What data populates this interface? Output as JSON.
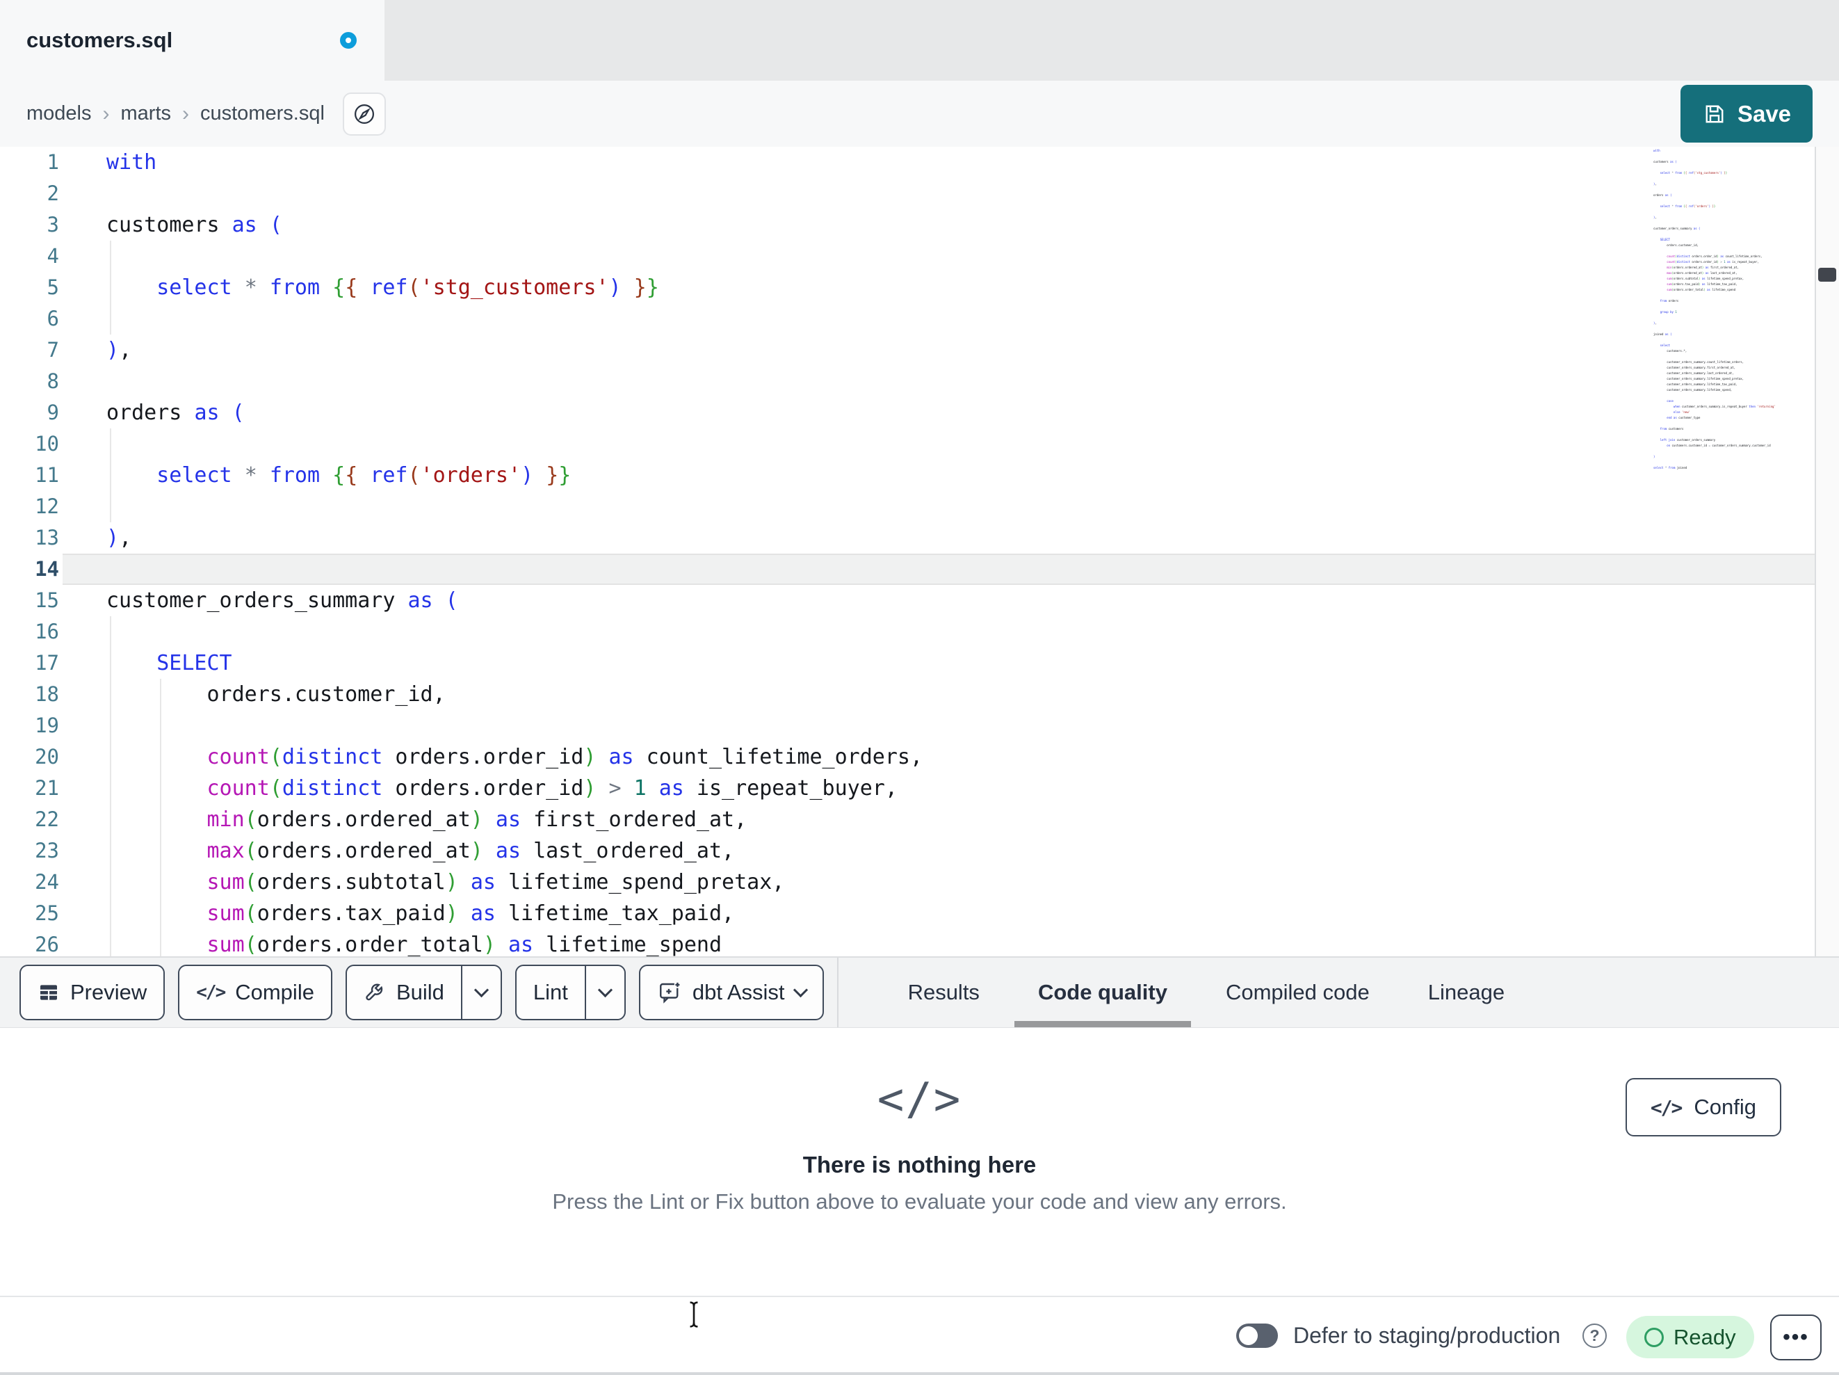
{
  "tab_bar": {
    "title": "customers.sql",
    "unsaved": true
  },
  "breadcrumb": {
    "items": [
      "models",
      "marts",
      "customers.sql"
    ],
    "separator": "›"
  },
  "header": {
    "save_label": "Save"
  },
  "icons": {
    "new_tab": "+",
    "help": "?",
    "more": "•••",
    "code_glyph": "</>"
  },
  "editor": {
    "visible_lines": 26,
    "active_line": 14,
    "lines": [
      {
        "t": [
          [
            "kw",
            "with"
          ]
        ]
      },
      {
        "t": []
      },
      {
        "t": [
          [
            "pl",
            "customers "
          ],
          [
            "kw",
            "as"
          ],
          [
            "pl",
            " "
          ],
          [
            "brb",
            "("
          ]
        ]
      },
      {
        "t": [],
        "g": [
          1
        ]
      },
      {
        "t": [
          [
            "pl",
            "    "
          ],
          [
            "kw",
            "select"
          ],
          [
            "pl",
            " "
          ],
          [
            "op",
            "*"
          ],
          [
            "pl",
            " "
          ],
          [
            "kw",
            "from"
          ],
          [
            "pl",
            " "
          ],
          [
            "brg",
            "{"
          ],
          [
            "brm",
            "{"
          ],
          [
            "pl",
            " "
          ],
          [
            "kw",
            "ref"
          ],
          [
            "brm",
            "("
          ],
          [
            "str",
            "'stg_customers'"
          ],
          [
            "brb",
            ")"
          ],
          [
            "pl",
            " "
          ],
          [
            "brm",
            "}"
          ],
          [
            "brg",
            "}"
          ]
        ],
        "g": [
          1
        ]
      },
      {
        "t": [],
        "g": [
          1
        ]
      },
      {
        "t": [
          [
            "brb",
            ")"
          ],
          [
            "pl",
            ","
          ]
        ]
      },
      {
        "t": []
      },
      {
        "t": [
          [
            "pl",
            "orders "
          ],
          [
            "kw",
            "as"
          ],
          [
            "pl",
            " "
          ],
          [
            "brb",
            "("
          ]
        ]
      },
      {
        "t": [],
        "g": [
          1
        ]
      },
      {
        "t": [
          [
            "pl",
            "    "
          ],
          [
            "kw",
            "select"
          ],
          [
            "pl",
            " "
          ],
          [
            "op",
            "*"
          ],
          [
            "pl",
            " "
          ],
          [
            "kw",
            "from"
          ],
          [
            "pl",
            " "
          ],
          [
            "brg",
            "{"
          ],
          [
            "brm",
            "{"
          ],
          [
            "pl",
            " "
          ],
          [
            "kw",
            "ref"
          ],
          [
            "brm",
            "("
          ],
          [
            "str",
            "'orders'"
          ],
          [
            "brb",
            ")"
          ],
          [
            "pl",
            " "
          ],
          [
            "brm",
            "}"
          ],
          [
            "brg",
            "}"
          ]
        ],
        "g": [
          1
        ]
      },
      {
        "t": [],
        "g": [
          1
        ]
      },
      {
        "t": [
          [
            "brb",
            ")"
          ],
          [
            "pl",
            ","
          ]
        ]
      },
      {
        "t": []
      },
      {
        "t": [
          [
            "pl",
            "customer_orders_summary "
          ],
          [
            "kw",
            "as"
          ],
          [
            "pl",
            " "
          ],
          [
            "brb",
            "("
          ]
        ]
      },
      {
        "t": [],
        "g": [
          1
        ]
      },
      {
        "t": [
          [
            "pl",
            "    "
          ],
          [
            "kw",
            "SELECT"
          ]
        ],
        "g": [
          1
        ]
      },
      {
        "t": [
          [
            "pl",
            "        orders.customer_id,"
          ]
        ],
        "g": [
          1,
          2
        ]
      },
      {
        "t": [],
        "g": [
          1,
          2
        ]
      },
      {
        "t": [
          [
            "pl",
            "        "
          ],
          [
            "fn",
            "count"
          ],
          [
            "brg",
            "("
          ],
          [
            "kw",
            "distinct"
          ],
          [
            "pl",
            " orders.order_id"
          ],
          [
            "brg",
            ")"
          ],
          [
            "pl",
            " "
          ],
          [
            "kw",
            "as"
          ],
          [
            "pl",
            " count_lifetime_orders,"
          ]
        ],
        "g": [
          1,
          2
        ]
      },
      {
        "t": [
          [
            "pl",
            "        "
          ],
          [
            "fn",
            "count"
          ],
          [
            "brg",
            "("
          ],
          [
            "kw",
            "distinct"
          ],
          [
            "pl",
            " orders.order_id"
          ],
          [
            "brg",
            ")"
          ],
          [
            "pl",
            " "
          ],
          [
            "op",
            ">"
          ],
          [
            "pl",
            " "
          ],
          [
            "num",
            "1"
          ],
          [
            "pl",
            " "
          ],
          [
            "kw",
            "as"
          ],
          [
            "pl",
            " is_repeat_buyer,"
          ]
        ],
        "g": [
          1,
          2
        ]
      },
      {
        "t": [
          [
            "pl",
            "        "
          ],
          [
            "fn",
            "min"
          ],
          [
            "brg",
            "("
          ],
          [
            "pl",
            "orders.ordered_at"
          ],
          [
            "brg",
            ")"
          ],
          [
            "pl",
            " "
          ],
          [
            "kw",
            "as"
          ],
          [
            "pl",
            " first_ordered_at,"
          ]
        ],
        "g": [
          1,
          2
        ]
      },
      {
        "t": [
          [
            "pl",
            "        "
          ],
          [
            "fn",
            "max"
          ],
          [
            "brg",
            "("
          ],
          [
            "pl",
            "orders.ordered_at"
          ],
          [
            "brg",
            ")"
          ],
          [
            "pl",
            " "
          ],
          [
            "kw",
            "as"
          ],
          [
            "pl",
            " last_ordered_at,"
          ]
        ],
        "g": [
          1,
          2
        ]
      },
      {
        "t": [
          [
            "pl",
            "        "
          ],
          [
            "fn",
            "sum"
          ],
          [
            "brg",
            "("
          ],
          [
            "pl",
            "orders.subtotal"
          ],
          [
            "brg",
            ")"
          ],
          [
            "pl",
            " "
          ],
          [
            "kw",
            "as"
          ],
          [
            "pl",
            " lifetime_spend_pretax,"
          ]
        ],
        "g": [
          1,
          2
        ]
      },
      {
        "t": [
          [
            "pl",
            "        "
          ],
          [
            "fn",
            "sum"
          ],
          [
            "brg",
            "("
          ],
          [
            "pl",
            "orders.tax_paid"
          ],
          [
            "brg",
            ")"
          ],
          [
            "pl",
            " "
          ],
          [
            "kw",
            "as"
          ],
          [
            "pl",
            " lifetime_tax_paid,"
          ]
        ],
        "g": [
          1,
          2
        ]
      },
      {
        "t": [
          [
            "pl",
            "        "
          ],
          [
            "fn",
            "sum"
          ],
          [
            "brg",
            "("
          ],
          [
            "pl",
            "orders.order_total"
          ],
          [
            "brg",
            ")"
          ],
          [
            "pl",
            " "
          ],
          [
            "kw",
            "as"
          ],
          [
            "pl",
            " lifetime_spend"
          ]
        ],
        "g": [
          1,
          2
        ]
      },
      {
        "t": []
      },
      {
        "t": [
          [
            "pl",
            "    "
          ],
          [
            "kw",
            "from"
          ],
          [
            "pl",
            " orders"
          ]
        ]
      },
      {
        "t": []
      },
      {
        "t": [
          [
            "pl",
            "    "
          ],
          [
            "kw",
            "group by"
          ],
          [
            "pl",
            " "
          ],
          [
            "num",
            "1"
          ]
        ]
      },
      {
        "t": []
      },
      {
        "t": [
          [
            "brb",
            ")"
          ],
          [
            "pl",
            ","
          ]
        ]
      },
      {
        "t": []
      },
      {
        "t": [
          [
            "pl",
            "joined "
          ],
          [
            "kw",
            "as"
          ],
          [
            "pl",
            " "
          ],
          [
            "brb",
            "("
          ]
        ]
      },
      {
        "t": []
      },
      {
        "t": [
          [
            "pl",
            "    "
          ],
          [
            "kw",
            "select"
          ]
        ]
      },
      {
        "t": [
          [
            "pl",
            "        customers.*,"
          ]
        ]
      },
      {
        "t": []
      },
      {
        "t": [
          [
            "pl",
            "        customer_orders_summary.count_lifetime_orders,"
          ]
        ]
      },
      {
        "t": [
          [
            "pl",
            "        customer_orders_summary.first_ordered_at,"
          ]
        ]
      },
      {
        "t": [
          [
            "pl",
            "        customer_orders_summary.last_ordered_at,"
          ]
        ]
      },
      {
        "t": [
          [
            "pl",
            "        customer_orders_summary.lifetime_spend_pretax,"
          ]
        ]
      },
      {
        "t": [
          [
            "pl",
            "        customer_orders_summary.lifetime_tax_paid,"
          ]
        ]
      },
      {
        "t": [
          [
            "pl",
            "        customer_orders_summary.lifetime_spend,"
          ]
        ]
      },
      {
        "t": []
      },
      {
        "t": [
          [
            "pl",
            "        "
          ],
          [
            "kw",
            "case"
          ]
        ]
      },
      {
        "t": [
          [
            "pl",
            "            "
          ],
          [
            "kw",
            "when"
          ],
          [
            "pl",
            " customer_orders_summary.is_repeat_buyer "
          ],
          [
            "kw",
            "then"
          ],
          [
            "pl",
            " "
          ],
          [
            "str",
            "'returning'"
          ]
        ]
      },
      {
        "t": [
          [
            "pl",
            "            "
          ],
          [
            "kw",
            "else"
          ],
          [
            "pl",
            " "
          ],
          [
            "str",
            "'new'"
          ]
        ]
      },
      {
        "t": [
          [
            "pl",
            "        "
          ],
          [
            "kw",
            "end"
          ],
          [
            "pl",
            " "
          ],
          [
            "kw",
            "as"
          ],
          [
            "pl",
            " customer_type"
          ]
        ]
      },
      {
        "t": []
      },
      {
        "t": [
          [
            "pl",
            "    "
          ],
          [
            "kw",
            "from"
          ],
          [
            "pl",
            " customers"
          ]
        ]
      },
      {
        "t": []
      },
      {
        "t": [
          [
            "pl",
            "    "
          ],
          [
            "kw",
            "left join"
          ],
          [
            "pl",
            " customer_orders_summary"
          ]
        ]
      },
      {
        "t": [
          [
            "pl",
            "        "
          ],
          [
            "kw",
            "on"
          ],
          [
            "pl",
            " customers.customer_id "
          ],
          [
            "op",
            "="
          ],
          [
            "pl",
            " customer_orders_summary.customer_id"
          ]
        ]
      },
      {
        "t": []
      },
      {
        "t": [
          [
            "brb",
            ")"
          ]
        ]
      },
      {
        "t": []
      },
      {
        "t": [
          [
            "kw",
            "select"
          ],
          [
            "pl",
            " "
          ],
          [
            "op",
            "*"
          ],
          [
            "pl",
            " "
          ],
          [
            "kw",
            "from"
          ],
          [
            "pl",
            " joined"
          ]
        ]
      }
    ]
  },
  "toolbar": {
    "buttons": [
      {
        "label": "Preview",
        "icon": "table-icon"
      },
      {
        "label": "Compile",
        "icon": "code-icon"
      },
      {
        "label": "Build",
        "icon": "wrench-icon"
      },
      {
        "label": "Lint"
      },
      {
        "label": "dbt Assist",
        "icon": "assist-chat-icon"
      }
    ],
    "tabs": [
      {
        "label": "Results"
      },
      {
        "label": "Code quality",
        "active": true
      },
      {
        "label": "Compiled code"
      },
      {
        "label": "Lineage"
      }
    ]
  },
  "panel": {
    "config_label": "Config",
    "empty_icon": "</>",
    "empty_title": "There is nothing here",
    "empty_subtitle": "Press the Lint or Fix button above to evaluate your code and view any errors."
  },
  "footer": {
    "defer_label": "Defer to staging/production",
    "status_label": "Ready"
  },
  "colors": {
    "accent_teal": "#156f7b",
    "unsaved_blue": "#0d9ddb",
    "ready_bg": "#d6f6de",
    "ready_green": "#2e9e63",
    "keyword_blue": "#2433e8",
    "function_magenta": "#b517b5",
    "string_red": "#a31515",
    "line_number_teal": "#44798c"
  }
}
